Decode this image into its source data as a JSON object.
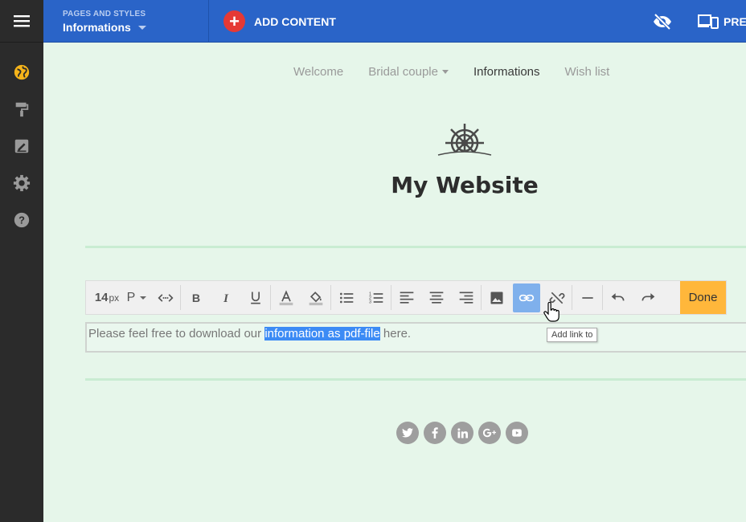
{
  "topbar": {
    "pages_label": "PAGES AND STYLES",
    "current_page": "Informations",
    "add_content": "ADD CONTENT",
    "preview_label": "PRE"
  },
  "nav": {
    "items": [
      "Welcome",
      "Bridal couple",
      "Informations",
      "Wish list"
    ],
    "active": "Informations"
  },
  "site": {
    "title": "My Website"
  },
  "toolbar": {
    "font_size": "14",
    "font_unit": "px",
    "paragraph_style": "P",
    "done_label": "Done",
    "tooltip": "Add link to"
  },
  "editor": {
    "text_before": "Please feel free to download our ",
    "text_selected": "information as pdf-file",
    "text_after": " here."
  },
  "social": [
    "twitter-icon",
    "facebook-icon",
    "linkedin-icon",
    "googleplus-icon",
    "youtube-icon"
  ],
  "colors": {
    "topbar": "#2a64c8",
    "sidebar": "#2b2b2b",
    "accent_sidebar": "#f6b41a",
    "page_bg": "#e6f6ea",
    "add_button": "#e53935",
    "done_button": "#ffb73b",
    "selection": "#3c8bf5",
    "link_active": "#7fb0ec"
  }
}
